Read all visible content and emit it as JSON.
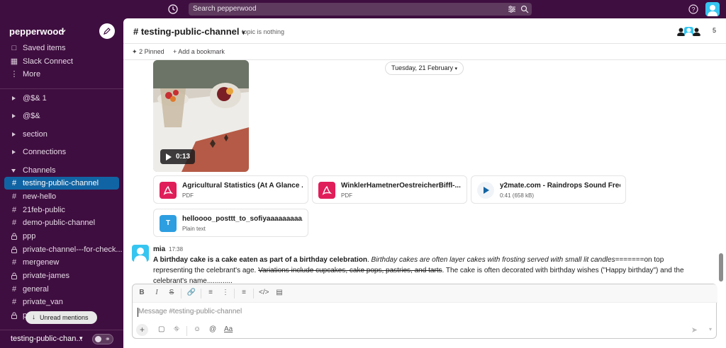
{
  "topbar": {
    "search_placeholder": "Search pepperwood"
  },
  "sidebar": {
    "workspace": "pepperwood",
    "nav": [
      {
        "label": "Saved items",
        "icon": "bookmark-icon"
      },
      {
        "label": "Slack Connect",
        "icon": "building-icon"
      },
      {
        "label": "More",
        "icon": "more-icon"
      }
    ],
    "sections": [
      {
        "label": "@$& 1"
      },
      {
        "label": "@$&"
      },
      {
        "label": "section"
      },
      {
        "label": "Connections"
      },
      {
        "label": "Channels"
      }
    ],
    "channels": [
      {
        "label": "testing-public-channel",
        "icon": "#",
        "active": true
      },
      {
        "label": "new-hello",
        "icon": "#"
      },
      {
        "label": "21feb-public",
        "icon": "#"
      },
      {
        "label": "demo-public-channel",
        "icon": "#"
      },
      {
        "label": "ppp",
        "icon": "lock"
      },
      {
        "label": "private-channel---for-check...",
        "icon": "lock"
      },
      {
        "label": "mergenew",
        "icon": "#"
      },
      {
        "label": "private-james",
        "icon": "lock"
      },
      {
        "label": "general",
        "icon": "#"
      },
      {
        "label": "private_van",
        "icon": "#"
      },
      {
        "label": "p",
        "icon": "lock"
      }
    ],
    "unread_mentions": "Unread mentions",
    "footer_channel": "testing-public-chan..."
  },
  "channel": {
    "title": "# testing-public-channel",
    "topic": "topic is nothing",
    "member_count": "5",
    "pinned": "2 Pinned",
    "add_bookmark": "Add a bookmark"
  },
  "date_divider": "Tuesday, 21 February",
  "video": {
    "duration": "0:13"
  },
  "files": [
    {
      "name": "Agricultural Statistics (At A Glance ...",
      "type": "PDF",
      "color": "#e01e5a"
    },
    {
      "name": "WinklerHametnerOestreicherBiffl-...",
      "type": "PDF",
      "color": "#e01e5a"
    },
    {
      "name": "y2mate.com - Raindrops Sound Free...",
      "type": "0:41 (658 kB)",
      "color": "#1264a3"
    },
    {
      "name": "helloooo_posttt_to_sofiyaaaaaaaaa...",
      "type": "Plain text",
      "color": "#2d9ee0"
    }
  ],
  "message": {
    "author": "mia",
    "time": "17:38",
    "bold": "A birthday cake is a cake eaten as part of a birthday celebration",
    "italic": "Birthday cakes are often layer cakes with frosting served with small lit candles",
    "after_italic": "=======on top representing the celebrant's age.",
    "strike": "Variations include cupcakes, cake pops, pastries, and tarts",
    "rest": ". The cake is often decorated with birthday wishes (\"Happy birthday\") and the celebrant's name............."
  },
  "composer": {
    "placeholder": "Message #testing-public-channel",
    "aa": "Aa"
  }
}
